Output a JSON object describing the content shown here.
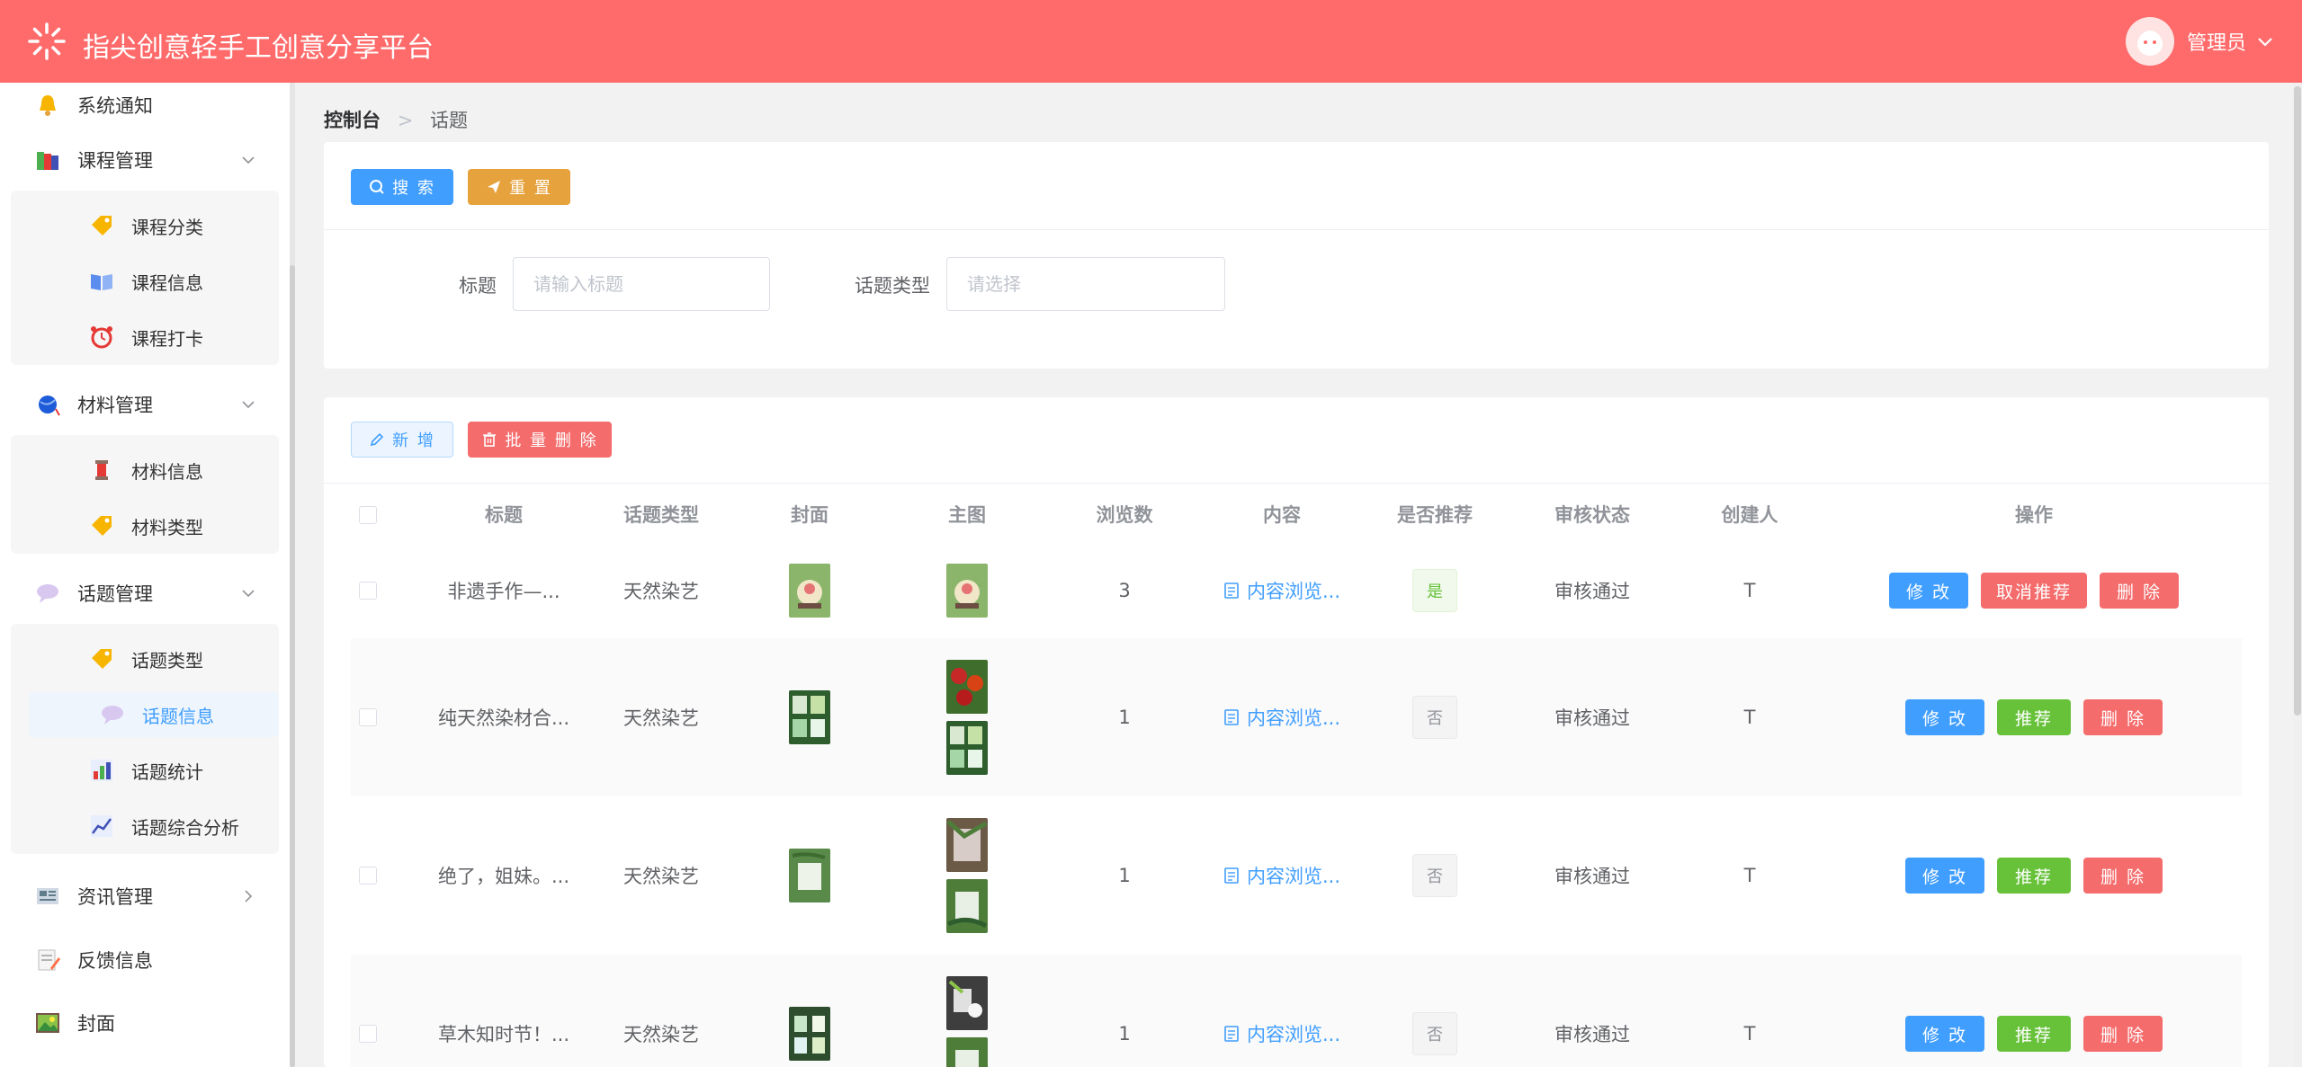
{
  "app": {
    "title": "指尖创意轻手工创意分享平台"
  },
  "user": {
    "name": "管理员"
  },
  "sidebar": {
    "items": [
      {
        "label": "系统通知"
      },
      {
        "label": "课程管理",
        "children": [
          {
            "label": "课程分类"
          },
          {
            "label": "课程信息"
          },
          {
            "label": "课程打卡"
          }
        ]
      },
      {
        "label": "材料管理",
        "children": [
          {
            "label": "材料信息"
          },
          {
            "label": "材料类型"
          }
        ]
      },
      {
        "label": "话题管理",
        "children": [
          {
            "label": "话题类型"
          },
          {
            "label": "话题信息"
          },
          {
            "label": "话题统计"
          },
          {
            "label": "话题综合分析"
          }
        ]
      },
      {
        "label": "资讯管理"
      },
      {
        "label": "反馈信息"
      },
      {
        "label": "封面"
      }
    ]
  },
  "breadcrumb": {
    "home": "控制台",
    "current": "话题"
  },
  "search": {
    "search_label": "搜 索",
    "reset_label": "重 置",
    "title_label": "标题",
    "title_placeholder": "请输入标题",
    "type_label": "话题类型",
    "type_placeholder": "请选择"
  },
  "toolbar": {
    "add_label": "新 增",
    "batch_delete_label": "批 量 删 除"
  },
  "table": {
    "headers": [
      "标题",
      "话题类型",
      "封面",
      "主图",
      "浏览数",
      "内容",
      "是否推荐",
      "审核状态",
      "创建人",
      "操作"
    ],
    "rows": [
      {
        "title": "非遗手作—...",
        "type": "天然染艺",
        "views": "3",
        "content": "内容浏览...",
        "recommend": "是",
        "status": "审核通过",
        "creator": "T",
        "ops": [
          "修 改",
          "取消推荐",
          "删 除"
        ]
      },
      {
        "title": "纯天然染材合...",
        "type": "天然染艺",
        "views": "1",
        "content": "内容浏览...",
        "recommend": "否",
        "status": "审核通过",
        "creator": "T",
        "ops": [
          "修 改",
          "推荐",
          "删 除"
        ]
      },
      {
        "title": "绝了，姐妹。...",
        "type": "天然染艺",
        "views": "1",
        "content": "内容浏览...",
        "recommend": "否",
        "status": "审核通过",
        "creator": "T",
        "ops": [
          "修 改",
          "推荐",
          "删 除"
        ]
      },
      {
        "title": "草木知时节！...",
        "type": "天然染艺",
        "views": "1",
        "content": "内容浏览...",
        "recommend": "否",
        "status": "审核通过",
        "creator": "T",
        "ops": [
          "修 改",
          "推荐",
          "删 除"
        ]
      }
    ]
  },
  "colors": {
    "header": "#ff6b6b",
    "primary": "#409eff",
    "warning": "#e6a23c",
    "danger": "#f56c6c",
    "success": "#67c23a"
  }
}
